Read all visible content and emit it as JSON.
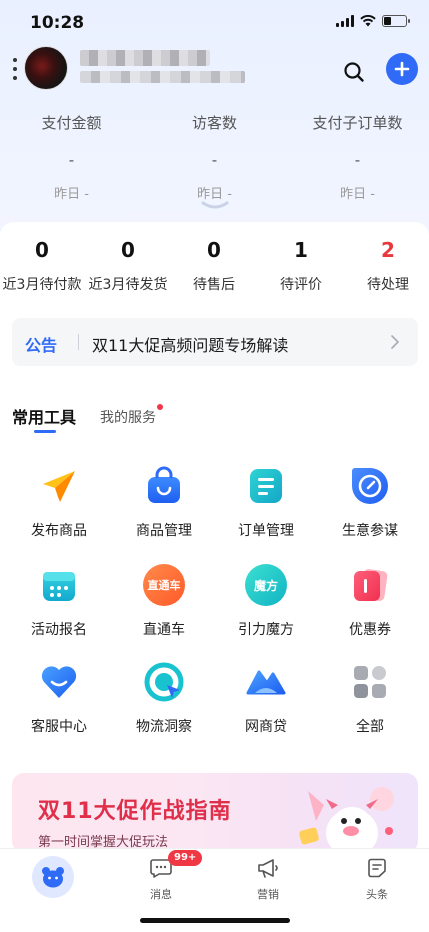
{
  "status_bar": {
    "time": "10:28"
  },
  "stats": [
    {
      "label": "支付金额",
      "value": "-",
      "yesterday": "昨日 -"
    },
    {
      "label": "访客数",
      "value": "-",
      "yesterday": "昨日 -"
    },
    {
      "label": "支付子订单数",
      "value": "-",
      "yesterday": "昨日 -"
    }
  ],
  "orders": [
    {
      "count": "0",
      "label": "近3月待付款"
    },
    {
      "count": "0",
      "label": "近3月待发货"
    },
    {
      "count": "0",
      "label": "待售后"
    },
    {
      "count": "1",
      "label": "待评价"
    },
    {
      "count": "2",
      "label": "待处理"
    }
  ],
  "notice": {
    "tag": "公告",
    "text": "双11大促高频问题专场解读"
  },
  "tabs": {
    "main": "常用工具",
    "sub": "我的服务"
  },
  "tools": [
    {
      "label": "发布商品",
      "icon": "paper-plane-icon"
    },
    {
      "label": "商品管理",
      "icon": "shopping-bag-icon"
    },
    {
      "label": "订单管理",
      "icon": "order-list-icon"
    },
    {
      "label": "生意参谋",
      "icon": "compass-icon"
    },
    {
      "label": "活动报名",
      "icon": "calendar-icon"
    },
    {
      "label": "直通车",
      "icon": "through-train-icon",
      "icon_text": "直通车"
    },
    {
      "label": "引力魔方",
      "icon": "gravity-cube-icon",
      "icon_text": "魔方"
    },
    {
      "label": "优惠券",
      "icon": "coupon-icon"
    },
    {
      "label": "客服中心",
      "icon": "heart-service-icon"
    },
    {
      "label": "物流洞察",
      "icon": "logistics-icon"
    },
    {
      "label": "网商贷",
      "icon": "mountain-loan-icon"
    },
    {
      "label": "全部",
      "icon": "grid-all-icon"
    }
  ],
  "banner": {
    "title": "双11大促作战指南",
    "subtitle": "第一时间掌握大促玩法"
  },
  "bottom_nav": [
    {
      "label": "",
      "icon": "home-bear-icon"
    },
    {
      "label": "消息",
      "icon": "message-icon",
      "badge": "99+"
    },
    {
      "label": "营销",
      "icon": "megaphone-icon"
    },
    {
      "label": "头条",
      "icon": "news-icon"
    }
  ],
  "colors": {
    "accent": "#2f6bf7",
    "alert": "#e8383d"
  }
}
